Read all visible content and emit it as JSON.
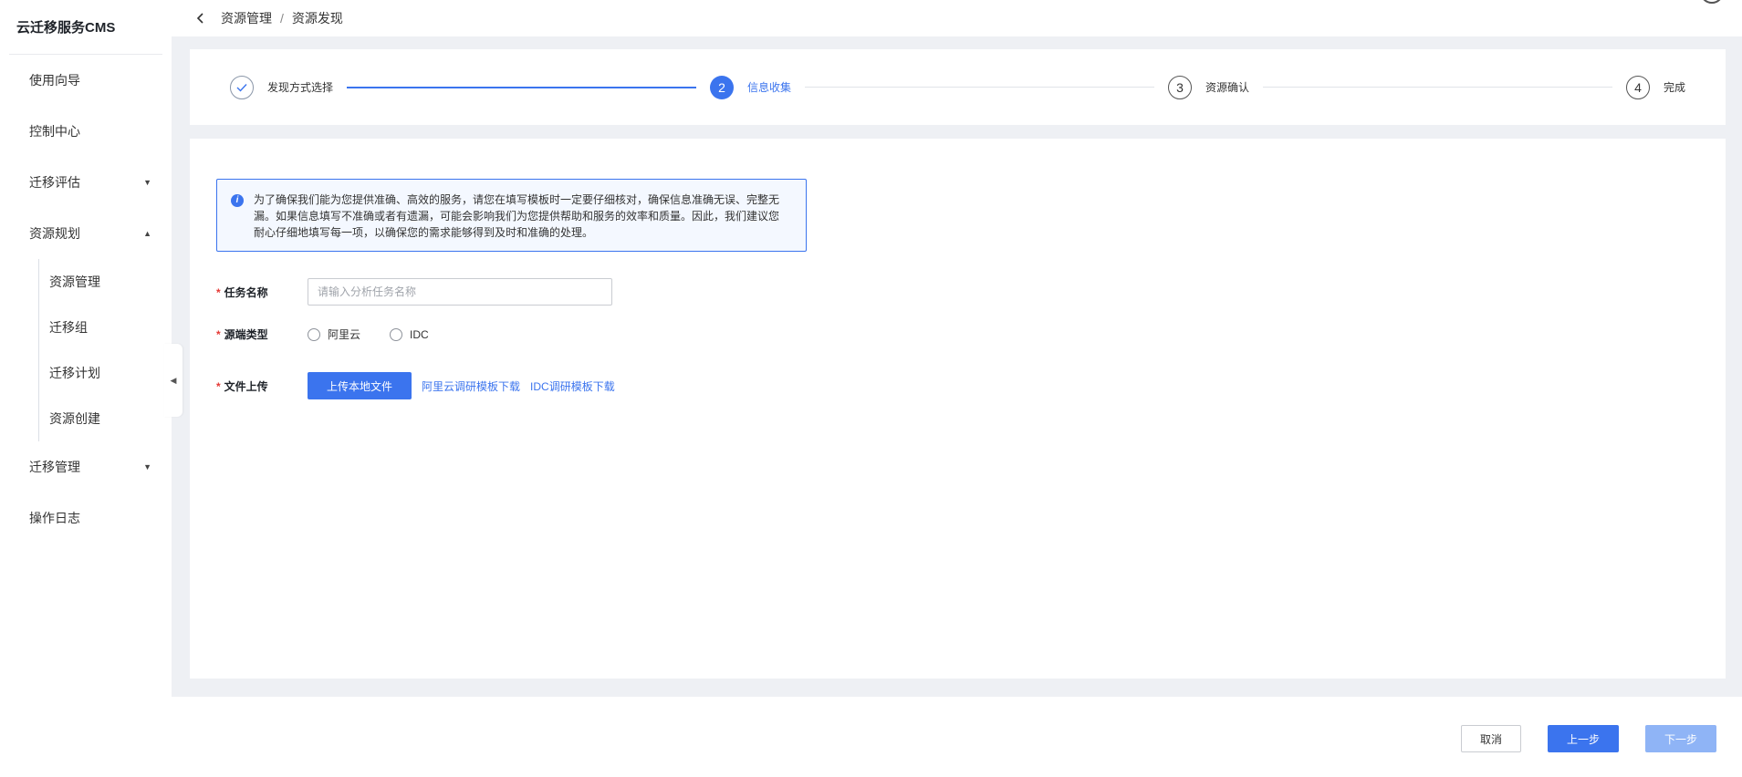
{
  "app": {
    "title": "云迁移服务CMS"
  },
  "sidebar": {
    "items": [
      {
        "label": "使用向导"
      },
      {
        "label": "控制中心"
      },
      {
        "label": "迁移评估",
        "caret": "▼"
      },
      {
        "label": "资源规划",
        "caret": "▲",
        "children": [
          {
            "label": "资源管理"
          },
          {
            "label": "迁移组"
          },
          {
            "label": "迁移计划"
          },
          {
            "label": "资源创建"
          }
        ]
      },
      {
        "label": "迁移管理",
        "caret": "▼"
      },
      {
        "label": "操作日志"
      }
    ]
  },
  "breadcrumb": {
    "parent": "资源管理",
    "separator": "/",
    "current": "资源发现"
  },
  "steps": [
    {
      "number": "1",
      "label": "发现方式选择",
      "status": "done"
    },
    {
      "number": "2",
      "label": "信息收集",
      "status": "active"
    },
    {
      "number": "3",
      "label": "资源确认",
      "status": "todo"
    },
    {
      "number": "4",
      "label": "完成",
      "status": "todo"
    }
  ],
  "notice": {
    "text": "为了确保我们能为您提供准确、高效的服务，请您在填写模板时一定要仔细核对，确保信息准确无误、完整无漏。如果信息填写不准确或者有遗漏，可能会影响我们为您提供帮助和服务的效率和质量。因此，我们建议您耐心仔细地填写每一项，以确保您的需求能够得到及时和准确的处理。"
  },
  "form": {
    "required_mark": "*",
    "task_name": {
      "label": "任务名称",
      "placeholder": "请输入分析任务名称",
      "value": ""
    },
    "source_type": {
      "label": "源端类型",
      "options": [
        "阿里云",
        "IDC"
      ]
    },
    "file_upload": {
      "label": "文件上传",
      "button": "上传本地文件",
      "link_aliyun": "阿里云调研模板下载",
      "link_idc": "IDC调研模板下载"
    }
  },
  "footer": {
    "cancel": "取消",
    "prev": "上一步",
    "next": "下一步"
  },
  "colors": {
    "primary": "#3b74ee",
    "primary_disabled": "#8fb4f6",
    "required": "#e53935"
  },
  "icons": {
    "back": "chevron-left-icon",
    "done_step": "check-icon",
    "notice": "info-icon",
    "collapse": "caret-left-icon"
  }
}
